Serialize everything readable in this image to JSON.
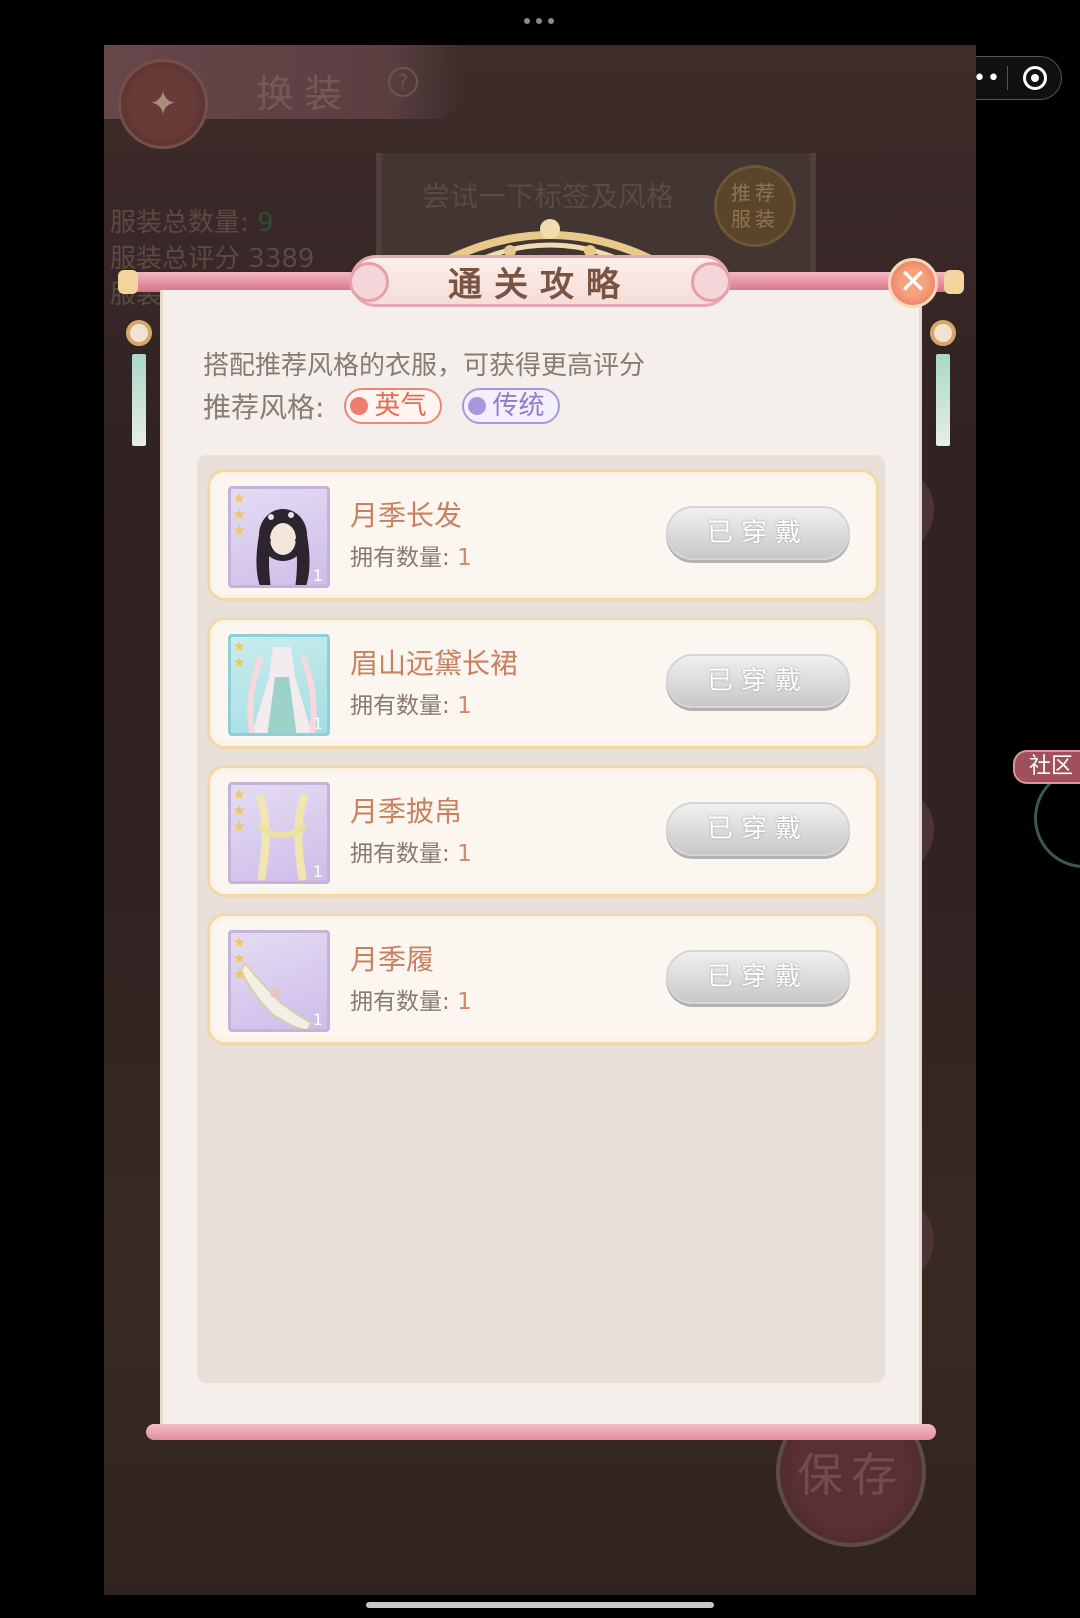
{
  "system": {
    "more_label": "•••",
    "top_indicator": "•••"
  },
  "background": {
    "title": "换装",
    "help": "?",
    "stats": [
      "服装总数量:",
      "9",
      "服装总评分",
      "3389",
      "服装"
    ],
    "banner_text": "尝试一下标签及风格",
    "recommend_button": "推荐\n服装",
    "save_button": "保存",
    "side_tab": "社区"
  },
  "modal": {
    "title": "通关攻略",
    "close_icon": "close-icon",
    "hint": "搭配推荐风格的衣服，可获得更高评分",
    "style_label": "推荐风格:",
    "styles": [
      {
        "label": "英气",
        "color": "#df6e58"
      },
      {
        "label": "传统",
        "color": "#8e7ccd"
      }
    ],
    "count_label": "拥有数量:",
    "items": [
      {
        "name": "月季长发",
        "count": "1",
        "stars": 3,
        "thumb_qty": "1",
        "button": "已穿戴"
      },
      {
        "name": "眉山远黛长裙",
        "count": "1",
        "stars": 2,
        "thumb_qty": "1",
        "button": "已穿戴"
      },
      {
        "name": "月季披帛",
        "count": "1",
        "stars": 3,
        "thumb_qty": "1",
        "button": "已穿戴"
      },
      {
        "name": "月季履",
        "count": "1",
        "stars": 3,
        "thumb_qty": "1",
        "button": "已穿戴"
      }
    ]
  }
}
